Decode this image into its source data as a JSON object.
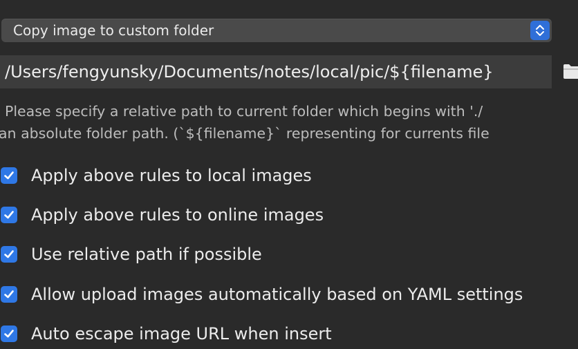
{
  "colors": {
    "background": "#2a2a2a",
    "accent": "#2f78e6",
    "control_bg": "#4a4a4a",
    "field_bg": "#3c3c3c"
  },
  "image_action_select": {
    "selected_value": "Copy image to custom folder",
    "icon": "up-down-chevron-icon"
  },
  "path_field": {
    "value": "/Users/fengyunsky/Documents/notes/local/pic/${filename}",
    "button_icon": "folder-icon"
  },
  "hint": {
    "line1": "Please specify a relative path to current folder which begins with './",
    "line2": "an absolute folder path. (`${filename}` representing for currents file"
  },
  "options": [
    {
      "label": "Apply above rules to local images",
      "checked": true
    },
    {
      "label": "Apply above rules to online images",
      "checked": true
    },
    {
      "label": "Use relative path if possible",
      "checked": true
    },
    {
      "label": "Allow upload images automatically based on YAML settings",
      "checked": true
    },
    {
      "label": "Auto escape image URL when insert",
      "checked": true
    }
  ]
}
